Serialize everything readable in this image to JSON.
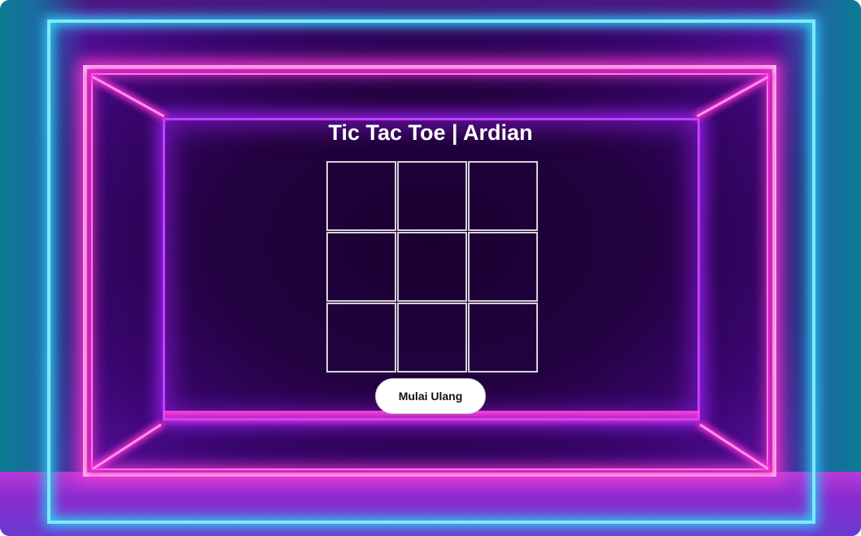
{
  "game": {
    "title": "Tic Tac Toe | Ardian",
    "board": [
      "",
      "",
      "",
      "",
      "",
      "",
      "",
      "",
      ""
    ],
    "restart_label": "Mulai Ulang"
  },
  "colors": {
    "neon_cyan": "#7ee8ff",
    "neon_pink": "#ff8ef0",
    "neon_purple": "#c040ff",
    "background_dark": "#1a0030"
  }
}
